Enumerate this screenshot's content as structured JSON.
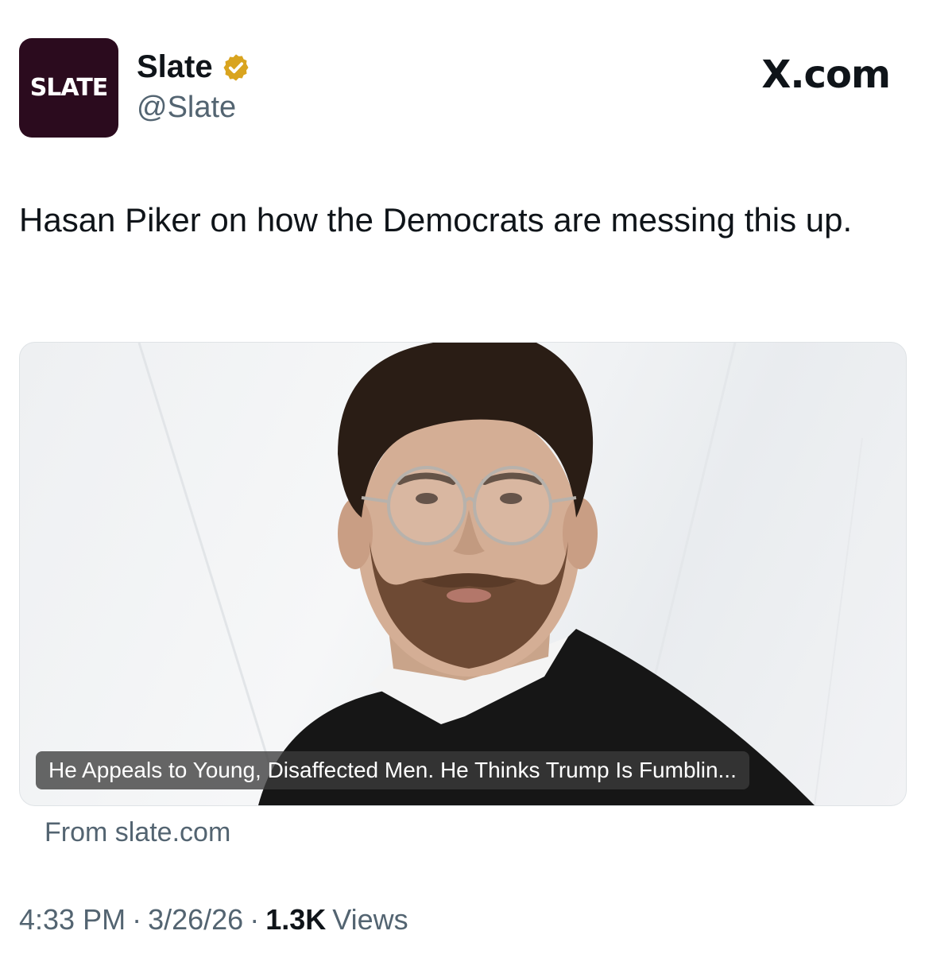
{
  "author": {
    "avatar_text": "SLATE",
    "display_name": "Slate",
    "handle": "@Slate",
    "verified": true,
    "verified_color": "#d9a41f"
  },
  "brand": {
    "site_logo": "X.com"
  },
  "tweet": {
    "text": "Hasan Piker on how the Democrats are messing this up."
  },
  "card": {
    "caption": "He Appeals to Young, Disaffected Men. He Thinks Trump Is Fumblin...",
    "source": "From slate.com"
  },
  "meta": {
    "time": "4:33 PM",
    "separator": "·",
    "date": "3/26/26",
    "views_count": "1.3K",
    "views_label": "Views"
  },
  "colors": {
    "avatar_bg": "#2b0b1e",
    "secondary_text": "#536471",
    "primary_text": "#0f1419"
  }
}
